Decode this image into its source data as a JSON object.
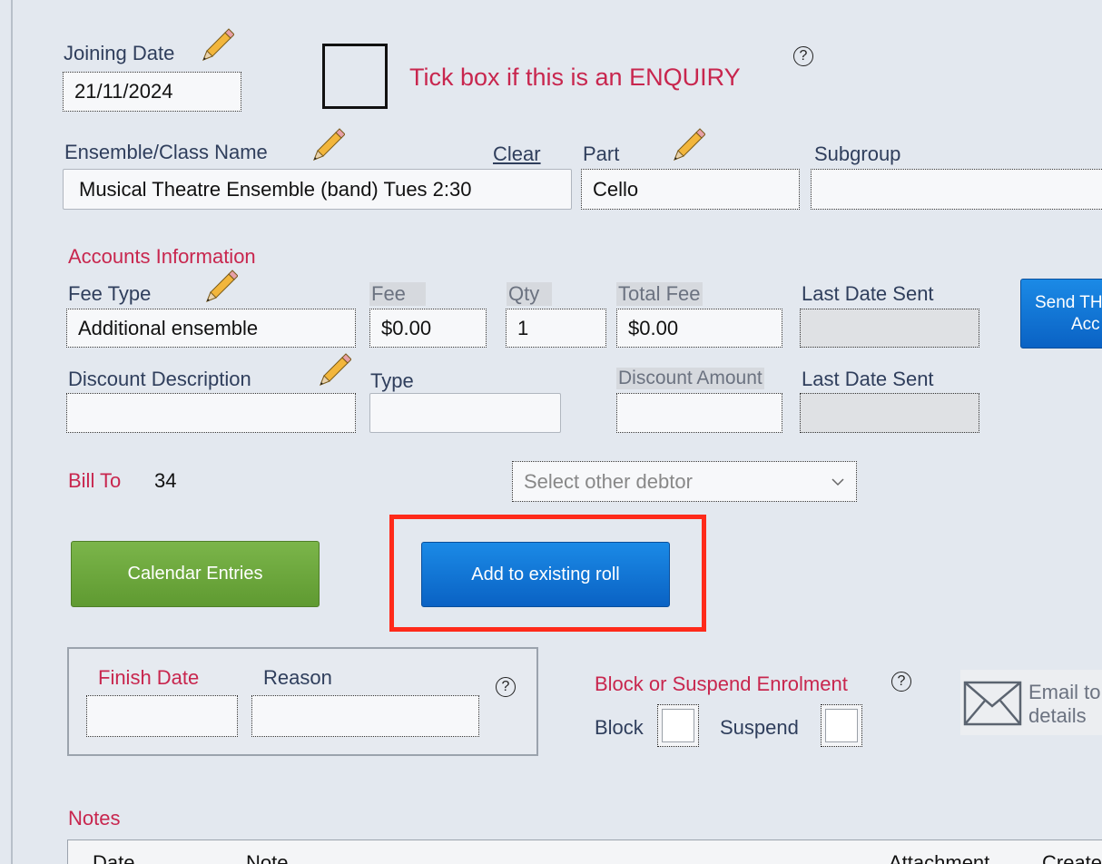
{
  "joining": {
    "label": "Joining Date",
    "value": "21/11/2024"
  },
  "enquiry": {
    "label": "Tick box if this is an ENQUIRY",
    "help": "?"
  },
  "ensemble": {
    "label": "Ensemble/Class Name",
    "clear": "Clear",
    "value": "Musical Theatre Ensemble (band) Tues 2:30"
  },
  "part": {
    "label": "Part",
    "value": "Cello"
  },
  "subgroup": {
    "label": "Subgroup",
    "value": ""
  },
  "accounts": {
    "heading": "Accounts Information",
    "fee_type": {
      "label": "Fee Type",
      "value": "Additional ensemble"
    },
    "fee": {
      "label": "Fee",
      "value": "$0.00"
    },
    "qty": {
      "label": "Qty",
      "value": "1"
    },
    "total_fee": {
      "label": "Total Fee",
      "value": "$0.00"
    },
    "last_date_sent_1": {
      "label": "Last Date Sent",
      "value": ""
    },
    "send_button": {
      "line1": "Send TH",
      "line2": "Acc"
    },
    "discount_description": {
      "label": "Discount Description",
      "value": ""
    },
    "type": {
      "label": "Type",
      "value": ""
    },
    "discount_amount": {
      "label": "Discount Amount",
      "value": ""
    },
    "last_date_sent_2": {
      "label": "Last Date Sent",
      "value": ""
    }
  },
  "bill_to": {
    "label": "Bill To",
    "value": "34"
  },
  "debtor_select": {
    "placeholder": "Select other debtor"
  },
  "buttons": {
    "calendar": "Calendar Entries",
    "add_roll": "Add to existing roll"
  },
  "finish": {
    "finish_label": "Finish Date",
    "reason_label": "Reason",
    "help": "?"
  },
  "block": {
    "heading": "Block or Suspend Enrolment",
    "help": "?",
    "block_label": "Block",
    "suspend_label": "Suspend"
  },
  "email": {
    "line1": "Email to",
    "line2": "details"
  },
  "notes": {
    "heading": "Notes",
    "columns": [
      "Date",
      "Note",
      "Attachment",
      "Create"
    ]
  },
  "colors": {
    "highlight": "#ff2a1a",
    "accent_red": "#c8264e",
    "button_blue": "#0a6fd6",
    "button_green": "#6aa63a"
  }
}
